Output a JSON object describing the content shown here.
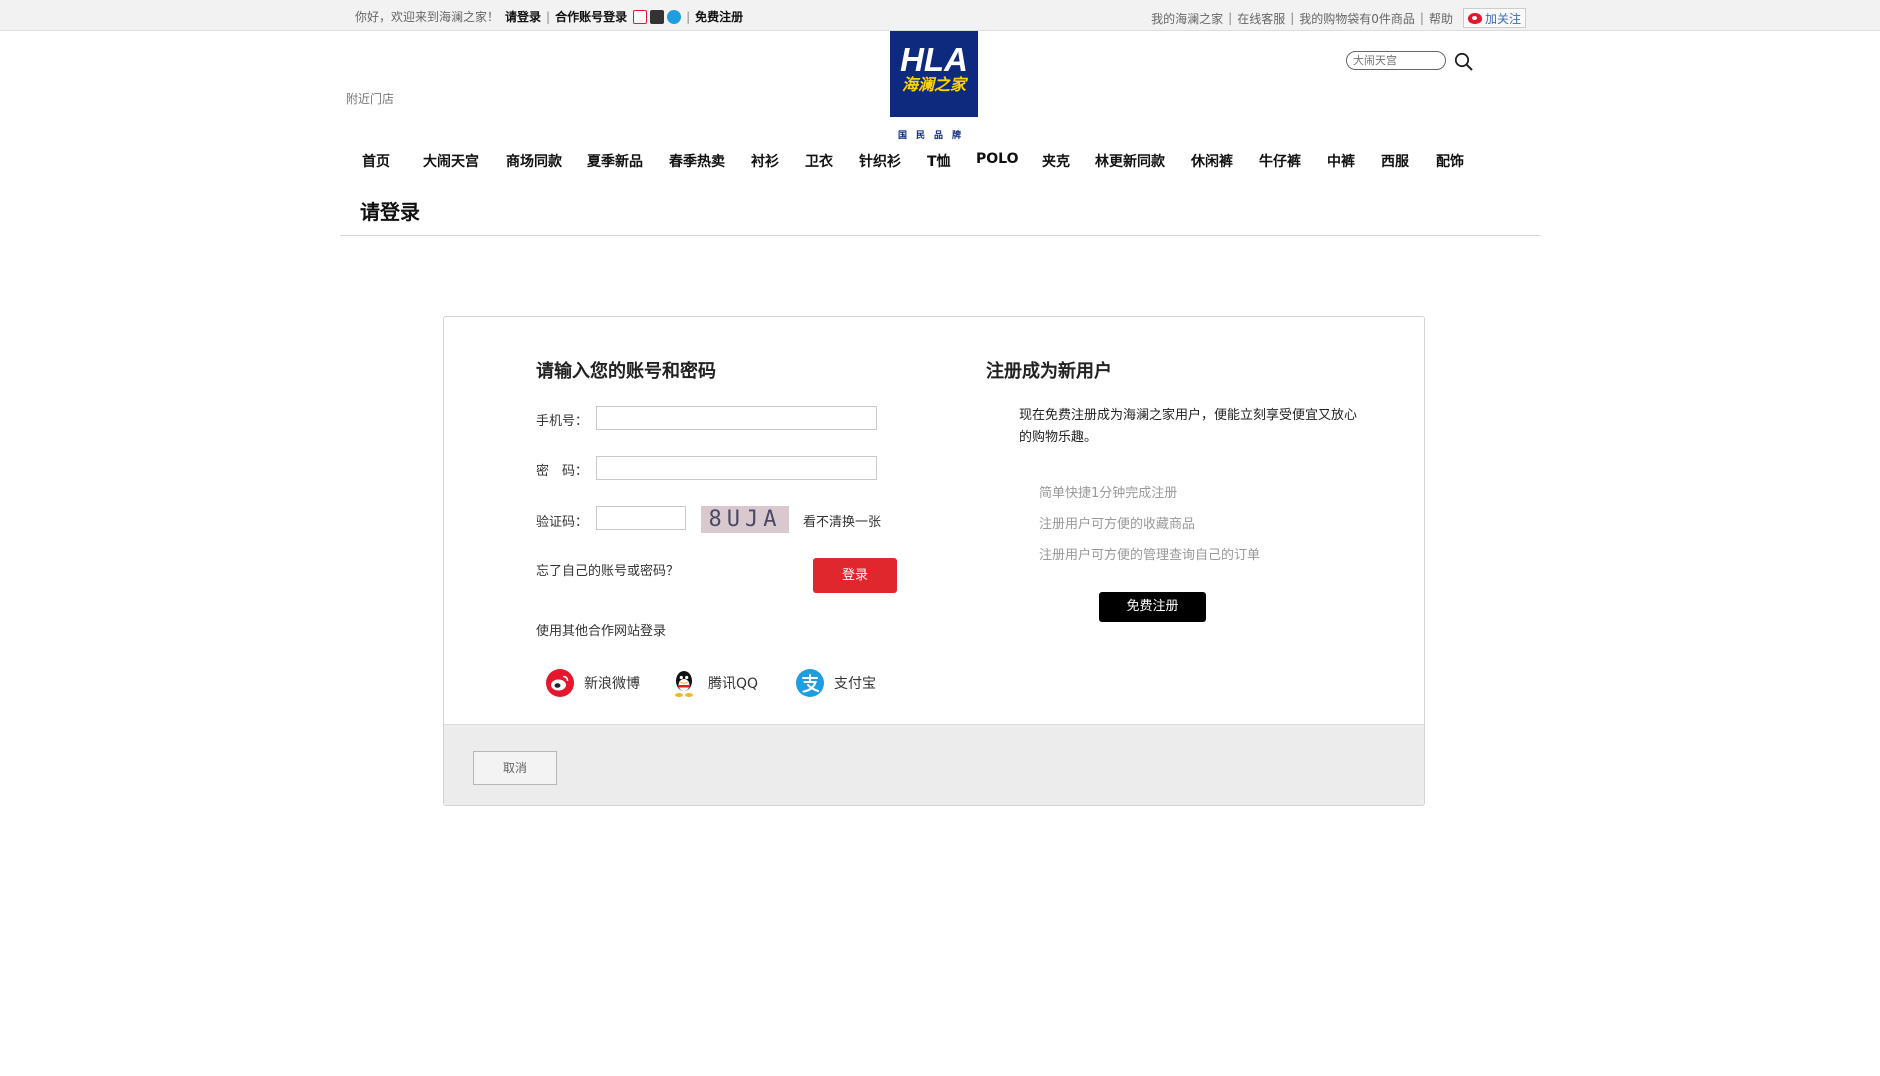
{
  "topbar": {
    "welcome": "你好，欢迎来到海澜之家！",
    "login_link": "请登录",
    "sep": "|",
    "partner_login": "合作账号登录",
    "register_link": "免费注册",
    "my_hla": "我的海澜之家",
    "service": "在线客服",
    "cart": "我的购物袋有0件商品",
    "help": "帮助",
    "follow": "加关注"
  },
  "header": {
    "logo_text": "HLA",
    "logo_cn": "海澜之家",
    "tagline": "国民品牌",
    "near_store": "附近门店",
    "search_placeholder": "大闹天宫"
  },
  "nav": [
    "首页",
    "大闹天宫",
    "商场同款",
    "夏季新品",
    "春季热卖",
    "衬衫",
    "卫衣",
    "针织衫",
    "T恤",
    "POLO",
    "夹克",
    "林更新同款",
    "休闲裤",
    "牛仔裤",
    "中裤",
    "西服",
    "配饰"
  ],
  "page_title": "请登录",
  "login": {
    "title": "请输入您的账号和密码",
    "phone_label": "手机号：",
    "password_label": "密　码：",
    "captcha_label": "验证码：",
    "captcha_text": "8UJA",
    "refresh": "看不清换一张",
    "forgot": "忘了自己的账号或密码？",
    "submit": "登录",
    "partner_title": "使用其他合作网站登录",
    "partners": [
      "新浪微博",
      "腾讯QQ",
      "支付宝"
    ]
  },
  "register": {
    "title": "注册成为新用户",
    "desc": "现在免费注册成为海澜之家用户，便能立刻享受便宜又放心的购物乐趣。",
    "benefits": [
      "简单快捷1分钟完成注册",
      "注册用户可方便的收藏商品",
      "注册用户可方便的管理查询自己的订单"
    ],
    "button": "免费注册"
  },
  "footer": {
    "cancel": "取消"
  },
  "colors": {
    "login_button": "#e0272d",
    "register_button": "#000000",
    "logo_bg": "#0d2a7e",
    "logo_cn": "#ffd200"
  }
}
